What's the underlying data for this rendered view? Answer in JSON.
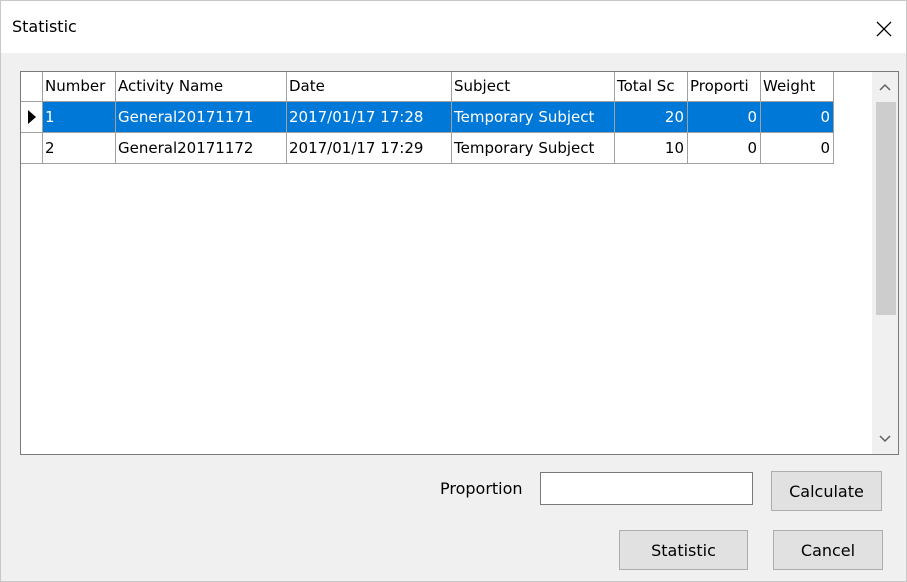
{
  "window": {
    "title": "Statistic",
    "close_glyph": "✕"
  },
  "grid": {
    "columns": [
      "",
      "Number",
      "Activity Name",
      "Date",
      "Subject",
      "Total Sc",
      "Proporti",
      "Weight"
    ],
    "rows": [
      {
        "number": "1",
        "activity_name": "General20171171",
        "date": "2017/01/17 17:28",
        "subject": "Temporary Subject",
        "total_score": "20",
        "proportion": "0",
        "weight": "0",
        "selected": true
      },
      {
        "number": "2",
        "activity_name": "General20171172",
        "date": "2017/01/17 17:29",
        "subject": "Temporary Subject",
        "total_score": "10",
        "proportion": "0",
        "weight": "0",
        "selected": false
      }
    ]
  },
  "form": {
    "proportion_label": "Proportion",
    "proportion_value": "",
    "calculate_label": "Calculate",
    "statistic_label": "Statistic",
    "cancel_label": "Cancel"
  },
  "icons": {
    "current_row": "triangle-right-icon",
    "scroll_up": "chevron-up-icon",
    "scroll_down": "chevron-down-icon",
    "close": "close-icon"
  },
  "colors": {
    "selection": "#0078d7",
    "background": "#f0f0f0"
  }
}
